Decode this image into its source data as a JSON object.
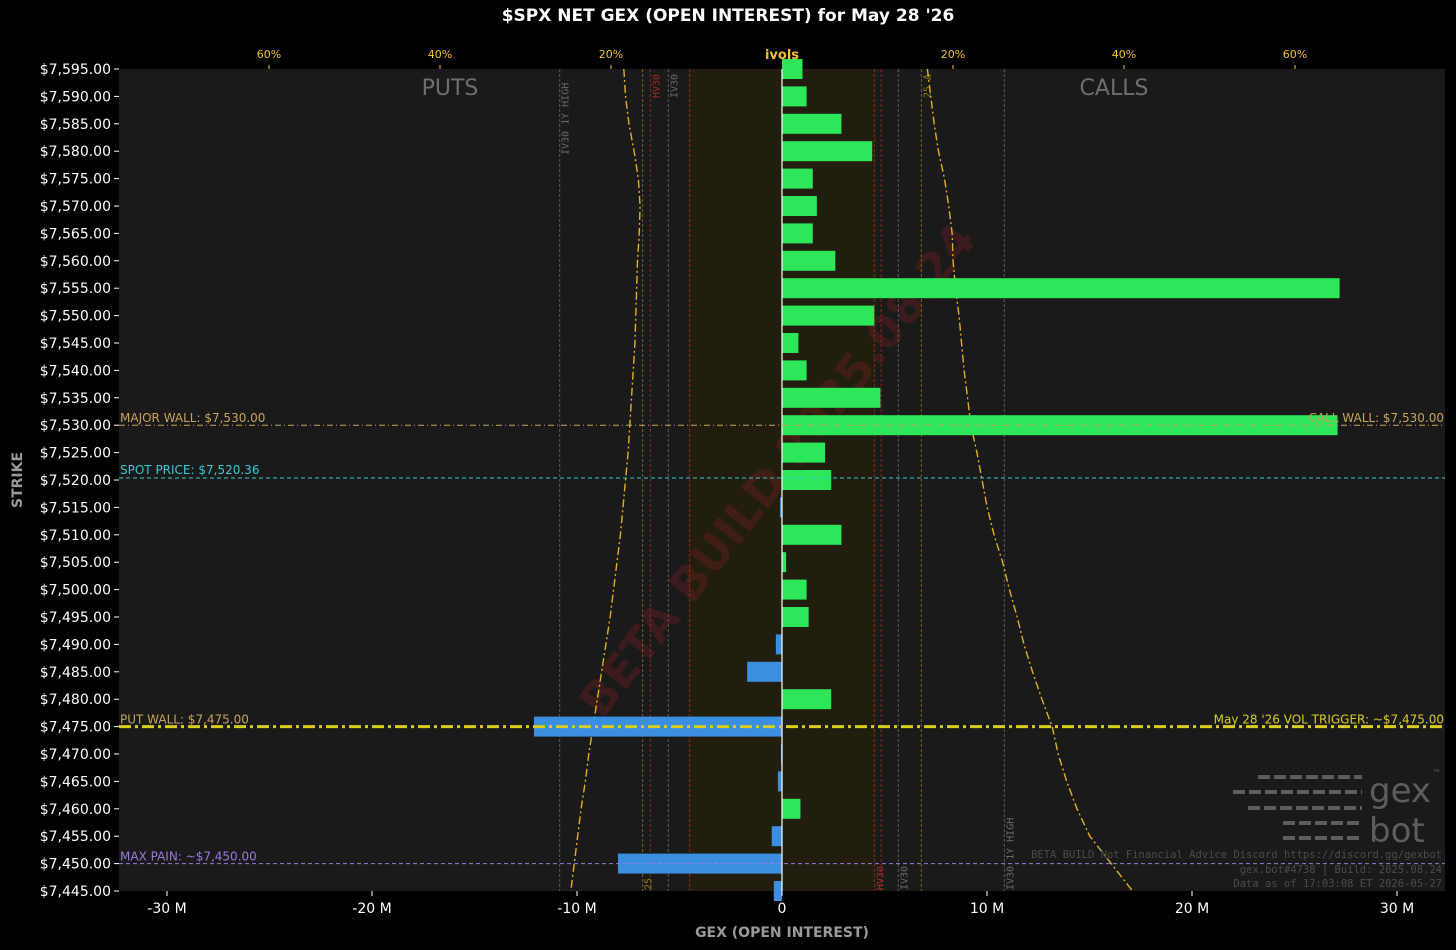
{
  "title": "$SPX NET GEX (OPEN INTEREST) for May 28 '26",
  "chart_data": {
    "type": "bar",
    "orientation": "horizontal",
    "xlabel": "GEX (OPEN INTEREST)",
    "ylabel": "STRIKE",
    "xlim": [
      -32.7,
      32.3
    ],
    "ylim": [
      7445,
      7595
    ],
    "x_ticks": [
      "-30 M",
      "-20 M",
      "-10 M",
      "0",
      "10 M",
      "20 M",
      "30 M"
    ],
    "x_tick_values": [
      -30,
      -20,
      -10,
      0,
      10,
      20,
      30
    ],
    "top_axis": {
      "label": "ivols",
      "ticks": [
        "60%",
        "40%",
        "20%",
        "20%",
        "40%",
        "60%"
      ],
      "tick_values": [
        -60,
        -40,
        -20,
        20,
        40,
        60
      ]
    },
    "side_labels": {
      "left": "PUTS",
      "right": "CALLS"
    },
    "strikes": [
      7595,
      7590,
      7585,
      7580,
      7575,
      7570,
      7565,
      7560,
      7555,
      7550,
      7545,
      7540,
      7535,
      7530,
      7525,
      7520,
      7515,
      7510,
      7505,
      7500,
      7495,
      7490,
      7485,
      7480,
      7475,
      7470,
      7465,
      7460,
      7455,
      7450,
      7445
    ],
    "strike_labels": [
      "$7,595.00",
      "$7,590.00",
      "$7,585.00",
      "$7,580.00",
      "$7,575.00",
      "$7,570.00",
      "$7,565.00",
      "$7,560.00",
      "$7,555.00",
      "$7,550.00",
      "$7,545.00",
      "$7,540.00",
      "$7,535.00",
      "$7,530.00",
      "$7,525.00",
      "$7,520.00",
      "$7,515.00",
      "$7,510.00",
      "$7,505.00",
      "$7,500.00",
      "$7,495.00",
      "$7,490.00",
      "$7,485.00",
      "$7,480.00",
      "$7,475.00",
      "$7,470.00",
      "$7,465.00",
      "$7,460.00",
      "$7,455.00",
      "$7,450.00",
      "$7,445.00"
    ],
    "gex_values": [
      1.0,
      1.2,
      2.9,
      4.4,
      1.5,
      1.7,
      1.5,
      2.6,
      27.2,
      4.5,
      0.8,
      1.2,
      4.8,
      27.1,
      2.1,
      2.4,
      -0.1,
      2.9,
      0.2,
      1.2,
      1.3,
      -0.3,
      -1.7,
      2.4,
      -12.1,
      -0.05,
      -0.2,
      0.9,
      -0.5,
      -8.0,
      -0.4
    ],
    "positive_color": "#2ee65a",
    "negative_color": "#3a8fe0",
    "levels": {
      "major_wall": {
        "label": "MAJOR WALL: $7,530.00",
        "strike": 7530,
        "color": "#c8a35a"
      },
      "call_wall": {
        "label": "CALL WALL: $7,530.00",
        "strike": 7530,
        "color": "#c8a35a"
      },
      "spot_price": {
        "label": "SPOT PRICE: $7,520.36",
        "strike": 7520.36,
        "color": "#36c9d6"
      },
      "put_wall": {
        "label": "PUT WALL: $7,475.00",
        "strike": 7475,
        "color": "#c8a35a"
      },
      "vol_trigger": {
        "label": "May 28 '26 VOL TRIGGER: ~$7,475.00",
        "strike": 7475,
        "color": "#d9cd1c"
      },
      "max_pain": {
        "label": "MAX PAIN: ~$7,450.00",
        "strike": 7450,
        "color": "#9a78e0"
      }
    },
    "vertical_markers": {
      "iv30_1y_high_put": "IV30 1Y HIGH",
      "iv30_1y_high_call": "IV30 1Y HIGH",
      "iv30_put": "IV30",
      "hv30_put": "HV30",
      "iv30_call": "IV30",
      "hv30_call": "HV30",
      "delta25_put": "25 Δ",
      "delta25_call": "25 Δ"
    },
    "put_iv_curve_pct": [
      [
        7595,
        -18.5
      ],
      [
        7590,
        -18.3
      ],
      [
        7585,
        -17.9
      ],
      [
        7580,
        -17.3
      ],
      [
        7575,
        -16.8
      ],
      [
        7570,
        -16.6
      ],
      [
        7565,
        -16.7
      ],
      [
        7560,
        -16.9
      ],
      [
        7555,
        -17.0
      ],
      [
        7550,
        -17.1
      ],
      [
        7545,
        -17.2
      ],
      [
        7540,
        -17.4
      ],
      [
        7535,
        -17.6
      ],
      [
        7530,
        -17.8
      ],
      [
        7525,
        -18.0
      ],
      [
        7520,
        -18.3
      ],
      [
        7515,
        -18.6
      ],
      [
        7510,
        -18.9
      ],
      [
        7505,
        -19.3
      ],
      [
        7500,
        -19.7
      ],
      [
        7495,
        -20.1
      ],
      [
        7490,
        -20.6
      ],
      [
        7485,
        -21.1
      ],
      [
        7480,
        -21.6
      ],
      [
        7475,
        -22.1
      ],
      [
        7470,
        -22.6
      ],
      [
        7465,
        -23.0
      ],
      [
        7460,
        -23.5
      ],
      [
        7455,
        -23.9
      ],
      [
        7450,
        -24.3
      ],
      [
        7445,
        -24.7
      ]
    ],
    "call_iv_curve_pct": [
      [
        7595,
        17.0
      ],
      [
        7590,
        17.4
      ],
      [
        7585,
        17.8
      ],
      [
        7580,
        18.3
      ],
      [
        7575,
        19.0
      ],
      [
        7570,
        19.5
      ],
      [
        7565,
        19.9
      ],
      [
        7560,
        20.0
      ],
      [
        7555,
        20.3
      ],
      [
        7550,
        20.7
      ],
      [
        7545,
        21.0
      ],
      [
        7540,
        21.3
      ],
      [
        7535,
        21.7
      ],
      [
        7530,
        22.1
      ],
      [
        7525,
        22.8
      ],
      [
        7520,
        23.4
      ],
      [
        7515,
        24.0
      ],
      [
        7510,
        24.8
      ],
      [
        7505,
        25.8
      ],
      [
        7500,
        26.6
      ],
      [
        7495,
        27.5
      ],
      [
        7490,
        28.3
      ],
      [
        7485,
        29.3
      ],
      [
        7480,
        30.4
      ],
      [
        7475,
        31.6
      ],
      [
        7470,
        32.3
      ],
      [
        7465,
        33.3
      ],
      [
        7460,
        34.5
      ],
      [
        7455,
        36.0
      ],
      [
        7450,
        38.5
      ],
      [
        7445,
        41.0
      ]
    ]
  },
  "watermark": "BETA BUILD 2025.08.24",
  "footer": {
    "line1": "BETA BUILD Not Financial Advice Discord https://discord.gg/gexbot",
    "line2": "gex.bot#4738 | Build: 2025.08.24",
    "line3": "Data as of 17:03:08 ET 2026-05-27"
  },
  "logo": {
    "line1": "gex",
    "line2": "bot",
    "tm": "™"
  }
}
